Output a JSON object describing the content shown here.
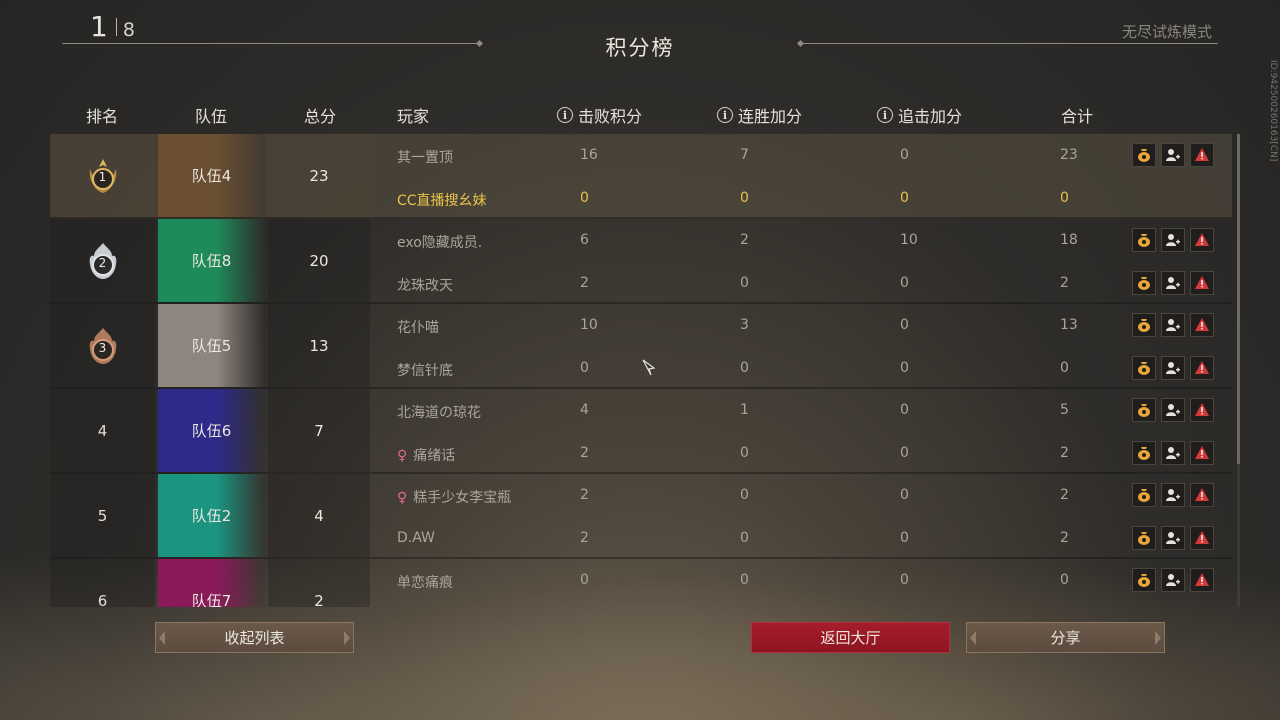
{
  "header": {
    "current": "1",
    "total": "8",
    "title": "积分榜",
    "mode": "无尽试炼模式",
    "side_id": "ID:942500260163[CN]"
  },
  "columns": {
    "rank": "排名",
    "team": "队伍",
    "total": "总分",
    "player": "玩家",
    "kill": "击败积分",
    "streak": "连胜加分",
    "chase": "追击加分",
    "sum": "合计"
  },
  "teams": [
    {
      "rank": "1",
      "rank_icon": "gold-laurel-emblem",
      "name": "队伍4",
      "score": "23",
      "color": "#6b4f33",
      "players": [
        {
          "name": "其一置顶",
          "female": false,
          "kill": "16",
          "streak": "7",
          "chase": "0",
          "sum": "23",
          "me": false,
          "actions": true
        },
        {
          "name": "CC直播搜幺妹",
          "female": false,
          "kill": "0",
          "streak": "0",
          "chase": "0",
          "sum": "0",
          "me": true,
          "actions": false
        }
      ]
    },
    {
      "rank": "2",
      "rank_icon": "silver-flame-emblem",
      "name": "队伍8",
      "score": "20",
      "color": "#1f8a5a",
      "players": [
        {
          "name": "exo隐藏成员.",
          "female": false,
          "kill": "6",
          "streak": "2",
          "chase": "10",
          "sum": "18",
          "me": false,
          "actions": true
        },
        {
          "name": "龙珠改天",
          "female": false,
          "kill": "2",
          "streak": "0",
          "chase": "0",
          "sum": "2",
          "me": false,
          "actions": true
        }
      ]
    },
    {
      "rank": "3",
      "rank_icon": "bronze-flame-emblem",
      "name": "队伍5",
      "score": "13",
      "color": "#8f8580",
      "players": [
        {
          "name": "花仆喵",
          "female": false,
          "kill": "10",
          "streak": "3",
          "chase": "0",
          "sum": "13",
          "me": false,
          "actions": true
        },
        {
          "name": "梦信针底",
          "female": false,
          "kill": "0",
          "streak": "0",
          "chase": "0",
          "sum": "0",
          "me": false,
          "actions": true
        }
      ]
    },
    {
      "rank": "4",
      "rank_icon": "",
      "name": "队伍6",
      "score": "7",
      "color": "#2e2a8a",
      "players": [
        {
          "name": "北海道の琼花",
          "female": false,
          "kill": "4",
          "streak": "1",
          "chase": "0",
          "sum": "5",
          "me": false,
          "actions": true
        },
        {
          "name": "痛绪话",
          "female": true,
          "kill": "2",
          "streak": "0",
          "chase": "0",
          "sum": "2",
          "me": false,
          "actions": true
        }
      ]
    },
    {
      "rank": "5",
      "rank_icon": "",
      "name": "队伍2",
      "score": "4",
      "color": "#1b9480",
      "players": [
        {
          "name": "糕手少女李宝瓶",
          "female": true,
          "kill": "2",
          "streak": "0",
          "chase": "0",
          "sum": "2",
          "me": false,
          "actions": true
        },
        {
          "name": "D.AW",
          "female": false,
          "kill": "2",
          "streak": "0",
          "chase": "0",
          "sum": "2",
          "me": false,
          "actions": true
        }
      ]
    },
    {
      "rank": "6",
      "rank_icon": "",
      "name": "队伍7",
      "score": "2",
      "color": "#8a1a5a",
      "players": [
        {
          "name": "单恋痛痕",
          "female": false,
          "kill": "0",
          "streak": "0",
          "chase": "0",
          "sum": "0",
          "me": false,
          "actions": true
        }
      ]
    }
  ],
  "female_symbol": "♀",
  "buttons": {
    "collapse": "收起列表",
    "lobby": "返回大厅",
    "share": "分享"
  },
  "icons": [
    "info-icon",
    "reward-bag-icon",
    "add-friend-icon",
    "report-icon"
  ],
  "colors": {
    "accent_red": "#a51d2c",
    "highlight_yellow": "#e8c34a",
    "button_brown": "#6b5a4a"
  }
}
